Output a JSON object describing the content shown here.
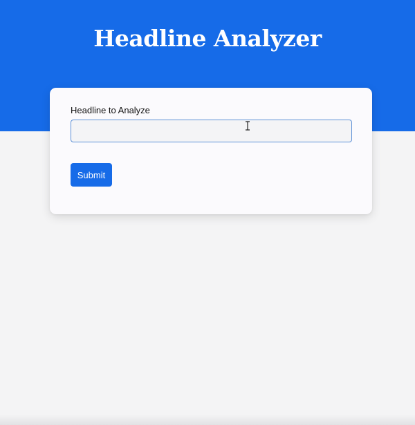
{
  "header": {
    "title": "Headline Analyzer"
  },
  "form": {
    "field_label": "Headline to Analyze",
    "input_value": "",
    "input_placeholder": "",
    "submit_label": "Submit"
  },
  "colors": {
    "brand_blue": "#166be8",
    "page_background": "#f4f4f5",
    "card_background": "#fbfafd",
    "input_border_focus": "#5b8fd6"
  },
  "icons": {
    "pointer": "text-cursor-icon"
  }
}
